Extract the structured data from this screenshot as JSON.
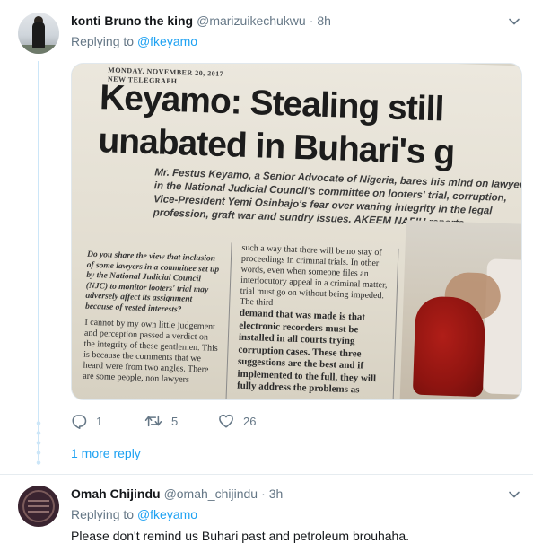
{
  "tweets": [
    {
      "display_name": "konti Bruno the king",
      "handle": "@marizuikechukwu",
      "time": "8h",
      "replying_prefix": "Replying to",
      "replying_to": "@fkeyamo",
      "media": {
        "date_line": "MONDAY, NOVEMBER 20, 2017",
        "paper_name": "NEW TELEGRAPH",
        "headline_line1": "Keyamo: Stealing still",
        "headline_line2": "unabated in Buhari's g",
        "standfirst": "Mr. Festus Keyamo, a Senior Advocate of Nigeria, bares his mind on lawyers in the National Judicial Council's committee on looters' trial, corruption, Vice-President Yemi Osinbajo's fear over waning integrity in the legal profession, graft war and sundry issues. AKEEM NAFIU reports",
        "col1_question": "Do you share the view that inclusion of some lawyers in a committee set up by the National Judicial Council (NJC) to monitor looters' trial may adversely affect its assignment because of vested interests?",
        "col1_body": "I cannot by my own little judgement and perception passed a verdict on the integrity of these gentlemen. This is because the comments that we heard were from two angles. There are some people, non lawyers",
        "col2_top": "such a way that there will be no stay of proceedings in criminal trials. In other words, even when someone files an interlocutory appeal in a criminal matter, trial must go on without being impeded. The third",
        "col2_strong": "demand that was made is that electronic recorders must be installed in all courts trying corruption cases. These three suggestions are the best and if implemented to the full, they will fully address the problems as"
      },
      "actions": {
        "reply_count": "1",
        "retweet_count": "5",
        "like_count": "26"
      },
      "more_replies": "1 more reply"
    },
    {
      "display_name": "Omah Chijindu",
      "handle": "@omah_chijindu",
      "time": "3h",
      "replying_prefix": "Replying to",
      "replying_to": "@fkeyamo",
      "text": "Please don't remind us Buhari past and petroleum brouhaha."
    }
  ],
  "separator": "·",
  "colors": {
    "link": "#1da1f2",
    "muted": "#657786",
    "text": "#14171a",
    "thread_line": "#cce6f8"
  },
  "icons": [
    "chevron-down-icon",
    "reply-icon",
    "retweet-icon",
    "heart-icon"
  ]
}
